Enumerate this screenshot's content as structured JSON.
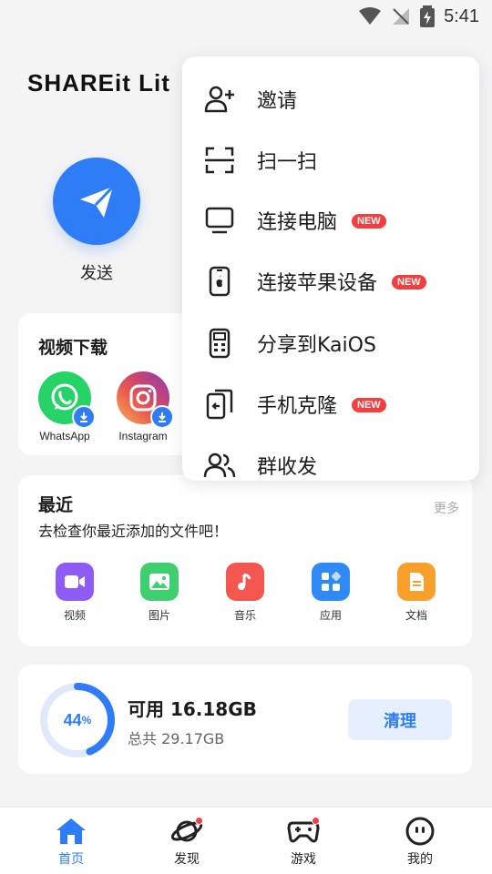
{
  "status": {
    "time": "5:41"
  },
  "logo": "SHAREit Lit",
  "send": {
    "label": "发送"
  },
  "video_download": {
    "title": "视频下载",
    "apps": [
      {
        "label": "WhatsApp",
        "icon": "whatsapp-icon",
        "color": "#25d366"
      },
      {
        "label": "Instagram",
        "icon": "instagram-icon",
        "color": "#d62976"
      }
    ]
  },
  "recent": {
    "title": "最近",
    "subtitle": "去检查你最近添加的文件吧！",
    "more": "更多",
    "categories": [
      {
        "label": "视频",
        "icon": "video-icon",
        "color": "#8e5cf5"
      },
      {
        "label": "图片",
        "icon": "image-icon",
        "color": "#3fcf6f"
      },
      {
        "label": "音乐",
        "icon": "music-icon",
        "color": "#f2564f"
      },
      {
        "label": "应用",
        "icon": "apps-icon",
        "color": "#2f8af5"
      },
      {
        "label": "文档",
        "icon": "document-icon",
        "color": "#f7a02c"
      }
    ]
  },
  "storage": {
    "percent": "44",
    "percent_sign": "%",
    "used_fraction": 0.44,
    "available": "可用 16.18GB",
    "total": "总共 29.17GB",
    "clean_label": "清理"
  },
  "nav": [
    {
      "label": "首页",
      "icon": "home-icon",
      "active": true
    },
    {
      "label": "发现",
      "icon": "planet-icon",
      "dot": true
    },
    {
      "label": "游戏",
      "icon": "gamepad-icon",
      "dot": true
    },
    {
      "label": "我的",
      "icon": "profile-icon"
    }
  ],
  "menu": {
    "items": [
      {
        "label": "邀请",
        "icon": "add-user-icon"
      },
      {
        "label": "扫一扫",
        "icon": "scan-icon"
      },
      {
        "label": "连接电脑",
        "icon": "monitor-icon",
        "badge": "NEW"
      },
      {
        "label": "连接苹果设备",
        "icon": "apple-device-icon",
        "badge": "NEW"
      },
      {
        "label": "分享到KaiOS",
        "icon": "feature-phone-icon"
      },
      {
        "label": "手机克隆",
        "icon": "phone-clone-icon",
        "badge": "NEW"
      },
      {
        "label": "群收发",
        "icon": "group-icon"
      }
    ]
  },
  "colors": {
    "accent": "#2f7df6",
    "badge": "#f23e3e"
  }
}
